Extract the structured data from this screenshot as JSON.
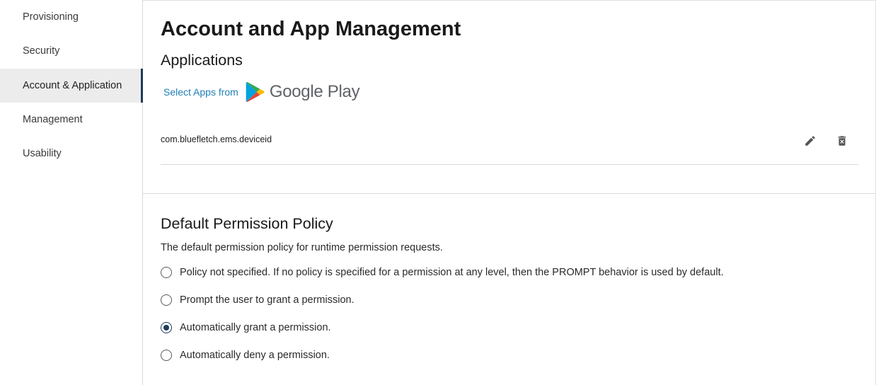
{
  "sidebar": {
    "items": [
      {
        "label": "Provisioning",
        "active": false
      },
      {
        "label": "Security",
        "active": false
      },
      {
        "label": "Account & Application",
        "active": true
      },
      {
        "label": "Management",
        "active": false
      },
      {
        "label": "Usability",
        "active": false
      }
    ]
  },
  "main": {
    "title": "Account and App Management",
    "applications": {
      "heading": "Applications",
      "select_apps_label": "Select Apps from",
      "store_name": "Google Play",
      "apps": [
        {
          "package": "com.bluefletch.ems.deviceid"
        }
      ]
    },
    "permission_policy": {
      "heading": "Default Permission Policy",
      "description": "The default permission policy for runtime permission requests.",
      "options": [
        {
          "label": "Policy not specified. If no policy is specified for a permission at any level, then the PROMPT behavior is used by default.",
          "checked": false
        },
        {
          "label": "Prompt the user to grant a permission.",
          "checked": false
        },
        {
          "label": "Automatically grant a permission.",
          "checked": true
        },
        {
          "label": "Automatically deny a permission.",
          "checked": false
        }
      ]
    }
  },
  "icons": {
    "edit": "pencil-icon",
    "delete": "trash-icon",
    "store": "google-play-icon"
  },
  "colors": {
    "accent": "#1d3b5a",
    "link": "#1f7fb8",
    "active_bg": "#ececec"
  }
}
